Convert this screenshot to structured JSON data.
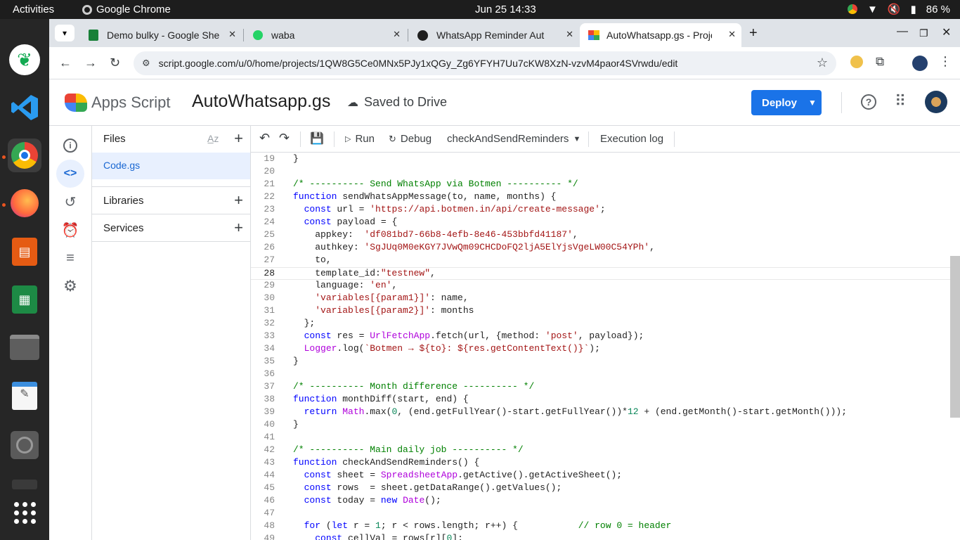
{
  "topbar": {
    "activities": "Activities",
    "app_name": "Google Chrome",
    "clock": "Jun 25  14:33",
    "battery": "86 %"
  },
  "tabs": [
    {
      "title": "Demo bulky - Google She",
      "icon": "sheets-icon"
    },
    {
      "title": "waba",
      "icon": "whatsapp-icon"
    },
    {
      "title": "WhatsApp Reminder Aut",
      "icon": "github-icon"
    },
    {
      "title": "AutoWhatsapp.gs - Proje",
      "icon": "apps-script-icon",
      "active": true
    }
  ],
  "url": "script.google.com/u/0/home/projects/1QW8G5Ce0MNx5PJy1xQGy_Zg6YFYH7Uu7cKW8XzN-vzvM4paor4SVrwdu/edit",
  "header": {
    "product": "Apps Script",
    "project": "AutoWhatsapp.gs",
    "saved": "Saved to Drive",
    "deploy": "Deploy"
  },
  "files": {
    "title": "Files",
    "items": [
      "Code.gs"
    ],
    "libraries": "Libraries",
    "services": "Services"
  },
  "toolbar": {
    "run": "Run",
    "debug": "Debug",
    "function": "checkAndSendReminders",
    "execution_log": "Execution log"
  },
  "editor": {
    "current_line": 28,
    "lines": [
      {
        "n": "19",
        "t": "}"
      },
      {
        "n": "20",
        "t": ""
      },
      {
        "n": "21",
        "t": "/* ---------- Send WhatsApp via Botmen ---------- */"
      },
      {
        "n": "22",
        "t": "function sendWhatsAppMessage(to, name, months) {"
      },
      {
        "n": "23",
        "t": "  const url = 'https://api.botmen.in/api/create-message';"
      },
      {
        "n": "24",
        "t": "  const payload = {"
      },
      {
        "n": "25",
        "t": "    appkey:  'df081bd7-66b8-4efb-8e46-453bbfd41187',"
      },
      {
        "n": "26",
        "t": "    authkey: 'SgJUq0M0eKGY7JVwQm09CHCDoFQ2ljA5ElYjsVgeLW00C54YPh',"
      },
      {
        "n": "27",
        "t": "    to,"
      },
      {
        "n": "28",
        "t": "    template_id:\"testnew\","
      },
      {
        "n": "29",
        "t": "    language: 'en',"
      },
      {
        "n": "30",
        "t": "    'variables[{param1}]': name,"
      },
      {
        "n": "31",
        "t": "    'variables[{param2}]': months"
      },
      {
        "n": "32",
        "t": "  };"
      },
      {
        "n": "33",
        "t": "  const res = UrlFetchApp.fetch(url, {method: 'post', payload});"
      },
      {
        "n": "34",
        "t": "  Logger.log(`Botmen → ${to}: ${res.getContentText()}`);"
      },
      {
        "n": "35",
        "t": "}"
      },
      {
        "n": "36",
        "t": ""
      },
      {
        "n": "37",
        "t": "/* ---------- Month difference ---------- */"
      },
      {
        "n": "38",
        "t": "function monthDiff(start, end) {"
      },
      {
        "n": "39",
        "t": "  return Math.max(0, (end.getFullYear()-start.getFullYear())*12 + (end.getMonth()-start.getMonth()));"
      },
      {
        "n": "40",
        "t": "}"
      },
      {
        "n": "41",
        "t": ""
      },
      {
        "n": "42",
        "t": "/* ---------- Main daily job ---------- */"
      },
      {
        "n": "43",
        "t": "function checkAndSendReminders() {"
      },
      {
        "n": "44",
        "t": "  const sheet = SpreadsheetApp.getActive().getActiveSheet();"
      },
      {
        "n": "45",
        "t": "  const rows  = sheet.getDataRange().getValues();"
      },
      {
        "n": "46",
        "t": "  const today = new Date();"
      },
      {
        "n": "47",
        "t": ""
      },
      {
        "n": "48",
        "t": "  for (let r = 1; r < rows.length; r++) {           // row 0 = header"
      },
      {
        "n": "49",
        "t": "    const cellVal = rows[r][0];"
      }
    ]
  },
  "colors": {
    "accent": "#1a73e8",
    "keyword": "#0000ff",
    "string": "#a31515",
    "comment": "#008000"
  }
}
